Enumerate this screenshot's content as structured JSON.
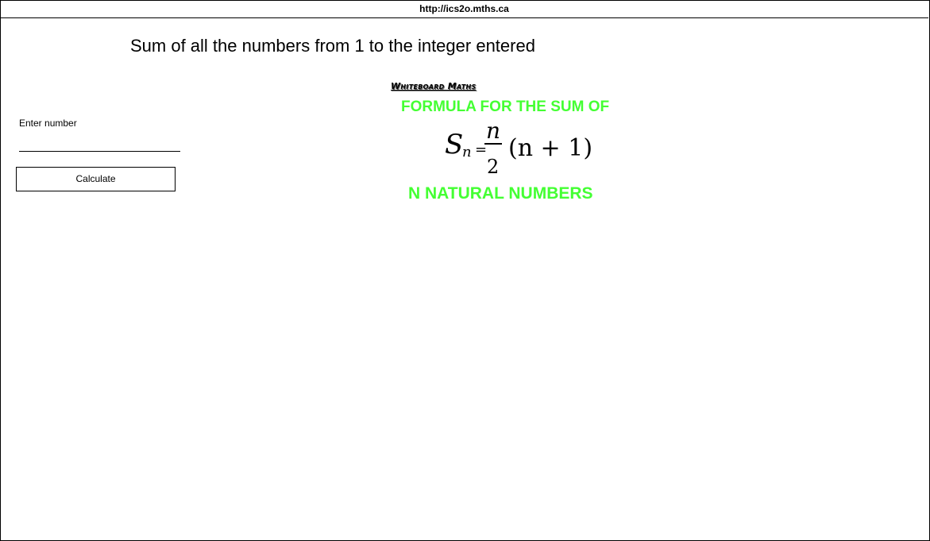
{
  "browser": {
    "url": "http://ics2o.mths.ca"
  },
  "page": {
    "title": "Sum of all the numbers from 1 to the integer entered"
  },
  "form": {
    "label": "Enter number",
    "input_value": "",
    "placeholder": "",
    "button_label": "Calculate"
  },
  "formula_image": {
    "brand": "Whiteboard Maths",
    "top_caption": "FORMULA FOR THE SUM OF",
    "bottom_caption": "N NATURAL NUMBERS",
    "equation": {
      "lhs": "S",
      "subscript": "n",
      "equals": "=",
      "numerator": "n",
      "denominator": "2",
      "rhs": "(n + 1)"
    },
    "caption_color": "#44ff33"
  }
}
